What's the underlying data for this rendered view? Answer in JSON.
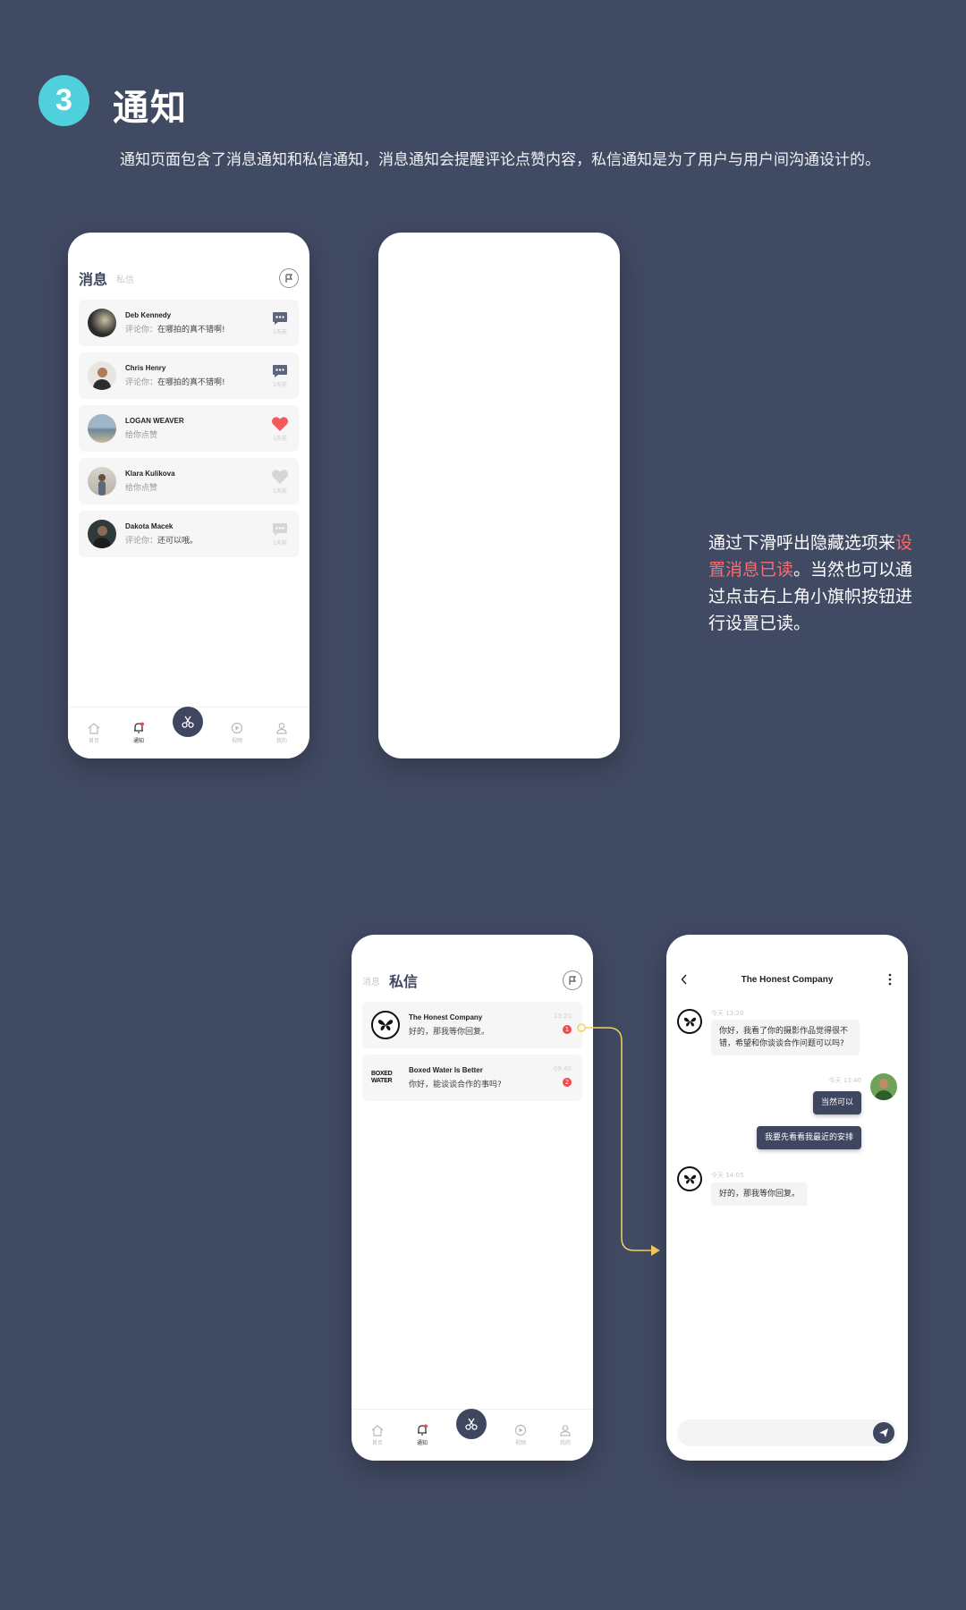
{
  "header": {
    "step_number": "3",
    "title": "通知",
    "description": "通知页面包含了消息通知和私信通知，消息通知会提醒评论点赞内容，私信通知是为了用户与用户间沟通设计的。"
  },
  "side_note": {
    "part1": "通过下滑呼出隐藏选项来",
    "highlight": "设置消息已读",
    "part2": "。当然也可以通过点击右上角小旗帜按钮进行设置已读。"
  },
  "notifications_screen": {
    "tab_active": "消息",
    "tab_inactive": "私信",
    "items": [
      {
        "name": "Deb Kennedy",
        "prefix": "评论你：",
        "content": "在哪拍的真不错啊!",
        "time": "1天前",
        "icon": "comment-icon",
        "icon_color": "#5b6481"
      },
      {
        "name": "Chris Henry",
        "prefix": "评论你：",
        "content": "在哪拍的真不错啊!",
        "time": "1天前",
        "icon": "comment-icon",
        "icon_color": "#5b6481"
      },
      {
        "name": "LOGAN WEAVER",
        "prefix": "给你点赞",
        "content": "",
        "time": "1天前",
        "icon": "heart-icon",
        "icon_color": "#f45a5a"
      },
      {
        "name": "Klara Kulikova",
        "prefix": "给你点赞",
        "content": "",
        "time": "1天前",
        "icon": "heart-icon",
        "icon_color": "#d6d6d6"
      },
      {
        "name": "Dakota Macek",
        "prefix": "评论你：",
        "content": "还可以哦。",
        "time": "1天前",
        "icon": "comment-icon",
        "icon_color": "#d6d6d6"
      }
    ]
  },
  "nav": {
    "home": "首页",
    "notify": "通知",
    "video": "视频",
    "profile": "我的"
  },
  "dm_screen": {
    "tab_inactive": "消息",
    "tab_active": "私信",
    "items": [
      {
        "name": "The Honest Company",
        "message": "好的，那我等你回复。",
        "time": "13:20",
        "badge": "1"
      },
      {
        "name": "Boxed Water Is Better",
        "logo_line1": "BOXED",
        "logo_line2": "WATER",
        "message": "你好，能谈谈合作的事吗?",
        "time": "09:40",
        "badge": "2"
      }
    ]
  },
  "chat_screen": {
    "title": "The Honest Company",
    "messages": [
      {
        "side": "in",
        "time": "今天 13:20",
        "text": "你好，我看了你的摄影作品觉得很不错，希望和你谈谈合作问题可以吗?"
      },
      {
        "side": "out",
        "time": "今天 13:40",
        "text": "当然可以"
      },
      {
        "side": "out",
        "time": "",
        "text": "我要先看看我最近的安排"
      },
      {
        "side": "in",
        "time": "今天 14:05",
        "text": "好的，那我等你回复。"
      }
    ]
  },
  "colors": {
    "background": "#414a63",
    "accent_teal": "#4fd0dc",
    "highlight_red": "#ff6b6b",
    "arrow_yellow": "#f5d15c",
    "navy": "#3e4660"
  }
}
